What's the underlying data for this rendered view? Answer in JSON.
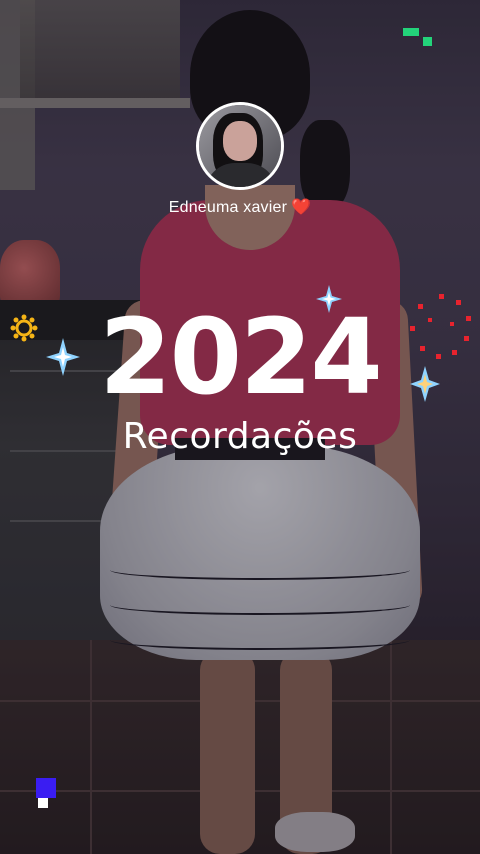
{
  "profile": {
    "name": "Edneuma xavier",
    "emoji": "❤️"
  },
  "memories": {
    "year": "2024",
    "title": "Recordações"
  },
  "colors": {
    "text": "#ffffff",
    "heart": "#e0233a",
    "sparkle_blue": "#8fd3ff",
    "sparkle_orange": "#ffb347",
    "dots_red": "#e8232e",
    "gear_yellow": "#f5b416",
    "pixels_green": "#23d37a",
    "pixels_blue": "#3a1df2"
  }
}
